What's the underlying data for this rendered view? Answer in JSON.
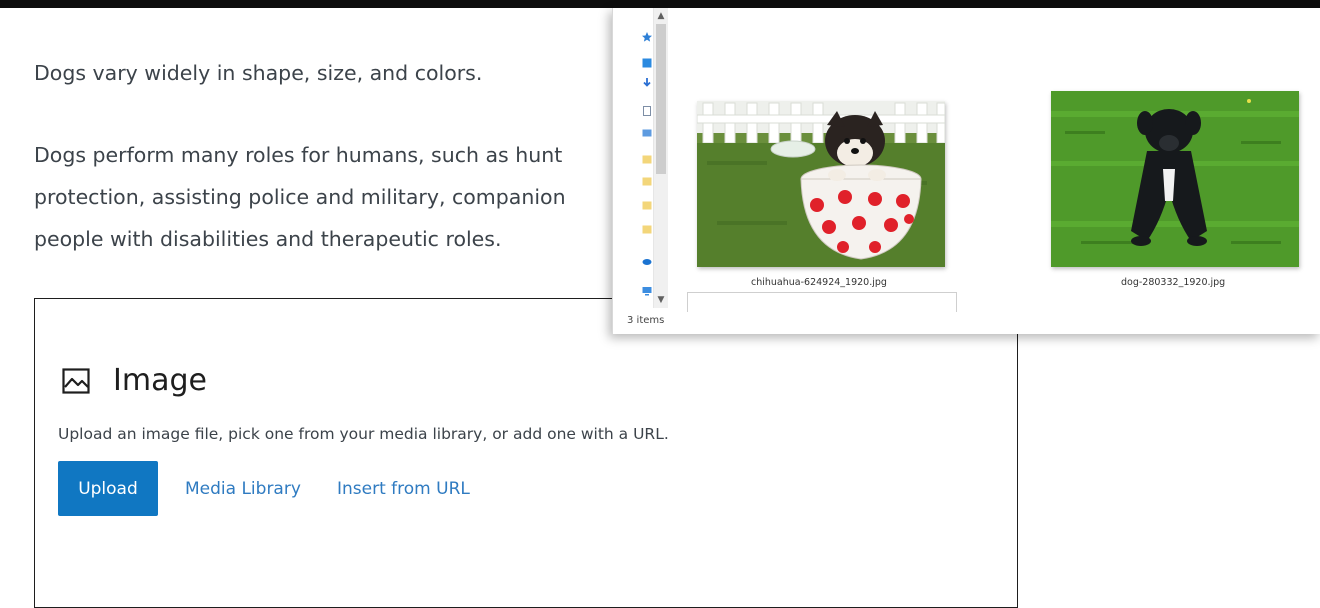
{
  "editor": {
    "paragraph_1": "Dogs vary widely in shape, size, and colors.",
    "paragraph_2_lines": [
      "Dogs perform many roles for humans, such as hunt",
      "protection, assisting police and military, companion",
      "people with disabilities and therapeutic roles."
    ]
  },
  "image_block": {
    "icon": "image-icon",
    "title": "Image",
    "instructions": "Upload an image file, pick one from your media library, or add one with a URL.",
    "upload_label": "Upload",
    "media_library_label": "Media Library",
    "insert_url_label": "Insert from URL"
  },
  "file_explorer": {
    "items": [
      {
        "name": "chihuahua-624924_1920.jpg",
        "icon": "chihuahua-puppy-in-polka-dot-cup-image"
      },
      {
        "name": "dog-280332_1920.jpg",
        "icon": "black-puppy-on-grass-image"
      }
    ],
    "status": "3 items",
    "nav_icons": [
      "quick-access-icon",
      "desktop-icon",
      "downloads-icon",
      "documents-icon",
      "pictures-icon",
      "folder-icon",
      "folder-icon",
      "folder-icon",
      "folder-icon",
      "onedrive-icon",
      "this-pc-icon"
    ]
  },
  "colors": {
    "upload_button": "#1077c2",
    "link": "#2f7bc1",
    "body_text": "#3c434a"
  }
}
